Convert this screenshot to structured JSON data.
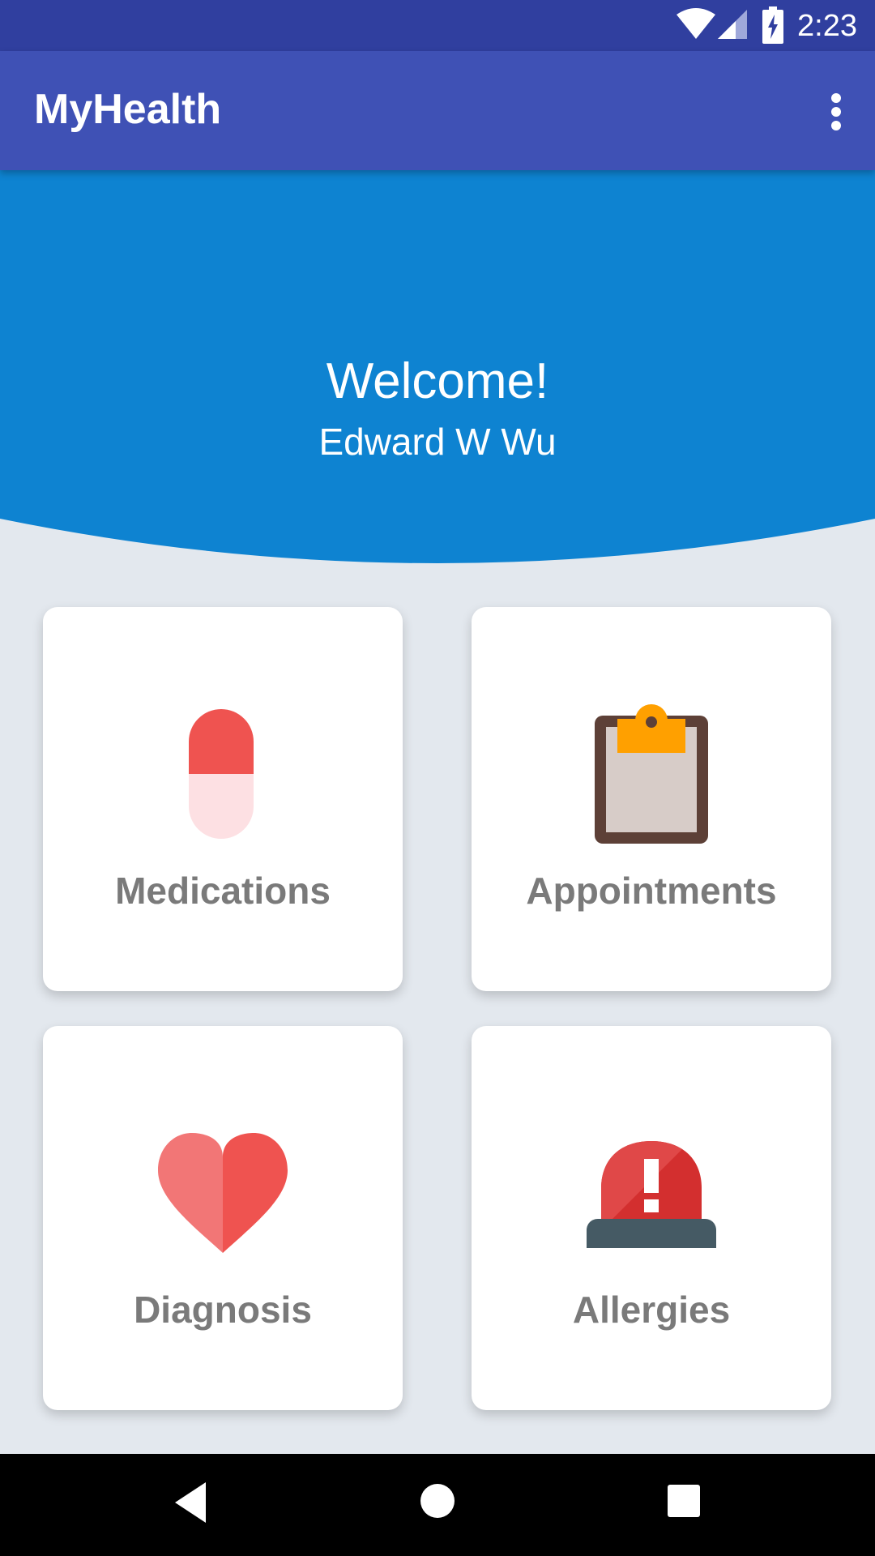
{
  "status_bar": {
    "time": "2:23",
    "icons": [
      "wifi-icon",
      "cell-signal-icon",
      "battery-charging-icon"
    ]
  },
  "app_bar": {
    "title": "MyHealth",
    "menu_icon": "more-vert-icon"
  },
  "hero": {
    "greeting": "Welcome!",
    "user_name": "Edward W Wu",
    "background_color": "#0e83d1"
  },
  "tiles": [
    {
      "label": "Medications",
      "icon": "pill-icon"
    },
    {
      "label": "Appointments",
      "icon": "clipboard-icon"
    },
    {
      "label": "Diagnosis",
      "icon": "heart-icon"
    },
    {
      "label": "Allergies",
      "icon": "alarm-light-icon"
    }
  ],
  "nav_bar": {
    "buttons": [
      "back-icon",
      "home-icon",
      "recents-icon"
    ]
  },
  "colors": {
    "status_bar": "#303f9f",
    "app_bar": "#3f51b5",
    "page_background": "#e3e8ee",
    "tile_label": "#7a7a7a"
  }
}
